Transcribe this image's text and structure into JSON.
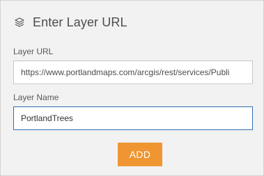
{
  "header": {
    "icon": "layers-icon",
    "title": "Enter Layer URL"
  },
  "form": {
    "url_label": "Layer URL",
    "url_value": "https://www.portlandmaps.com/arcgis/rest/services/Publi",
    "name_label": "Layer Name",
    "name_value": "PortlandTrees",
    "add_label": "ADD"
  },
  "colors": {
    "panel_bg": "#f2f2f2",
    "accent_button": "#ef9633",
    "focus_border": "#2f6db2",
    "title_text": "#4c4c4c"
  }
}
